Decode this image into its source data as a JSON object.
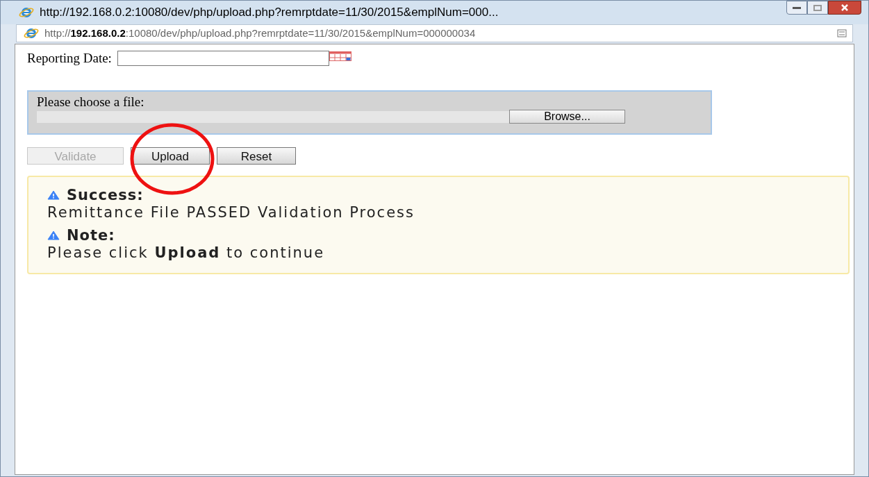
{
  "window": {
    "title": "http://192.168.0.2:10080/dev/php/upload.php?remrptdate=11/30/2015&emplNum=000..."
  },
  "address_bar": {
    "host": "192.168.0.2",
    "before_host": "http://",
    "after_host": ":10080/dev/php/upload.php?remrptdate=11/30/2015&emplNum=000000034"
  },
  "reporting_date": {
    "label": "Reporting Date:"
  },
  "file_panel": {
    "label": "Please choose a file:",
    "browse": "Browse..."
  },
  "buttons": [
    {
      "label": "Validate",
      "disabled": true
    },
    {
      "label": "Upload",
      "disabled": false
    },
    {
      "label": "Reset",
      "disabled": false
    }
  ],
  "messages": [
    {
      "title": "Success:",
      "text": "Remittance File PASSED Validation Process"
    },
    {
      "title": "Note:",
      "text": "Please click **Upload** to continue"
    }
  ]
}
